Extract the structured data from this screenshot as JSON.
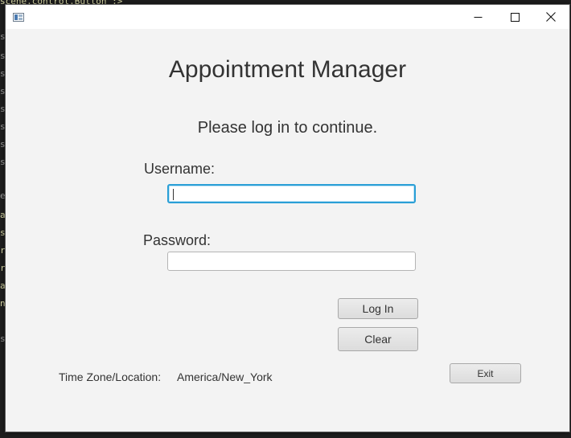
{
  "background": {
    "editor_lines": [
      "scene.control.Button\";>",
      "so",
      "so",
      "so",
      "so",
      "so",
      "so",
      "so",
      "so",
      "er",
      "ai",
      "st",
      "ra",
      "ri",
      "ai",
      "nn",
      "se"
    ]
  },
  "window": {
    "app_icon": "java-app-icon",
    "minimize_icon": "minimize-icon",
    "maximize_icon": "maximize-icon",
    "close_icon": "close-icon"
  },
  "main": {
    "title": "Appointment Manager",
    "subtitle": "Please log in to continue."
  },
  "form": {
    "username_label": "Username:",
    "username_value": "",
    "password_label": "Password:",
    "password_value": ""
  },
  "buttons": {
    "login": "Log In",
    "clear": "Clear",
    "exit": "Exit"
  },
  "footer": {
    "timezone_label": "Time Zone/Location:",
    "timezone_value": "America/New_York"
  },
  "colors": {
    "window_bg": "#f3f3f3",
    "focus_border": "#2a9fd6",
    "text": "#333333"
  }
}
